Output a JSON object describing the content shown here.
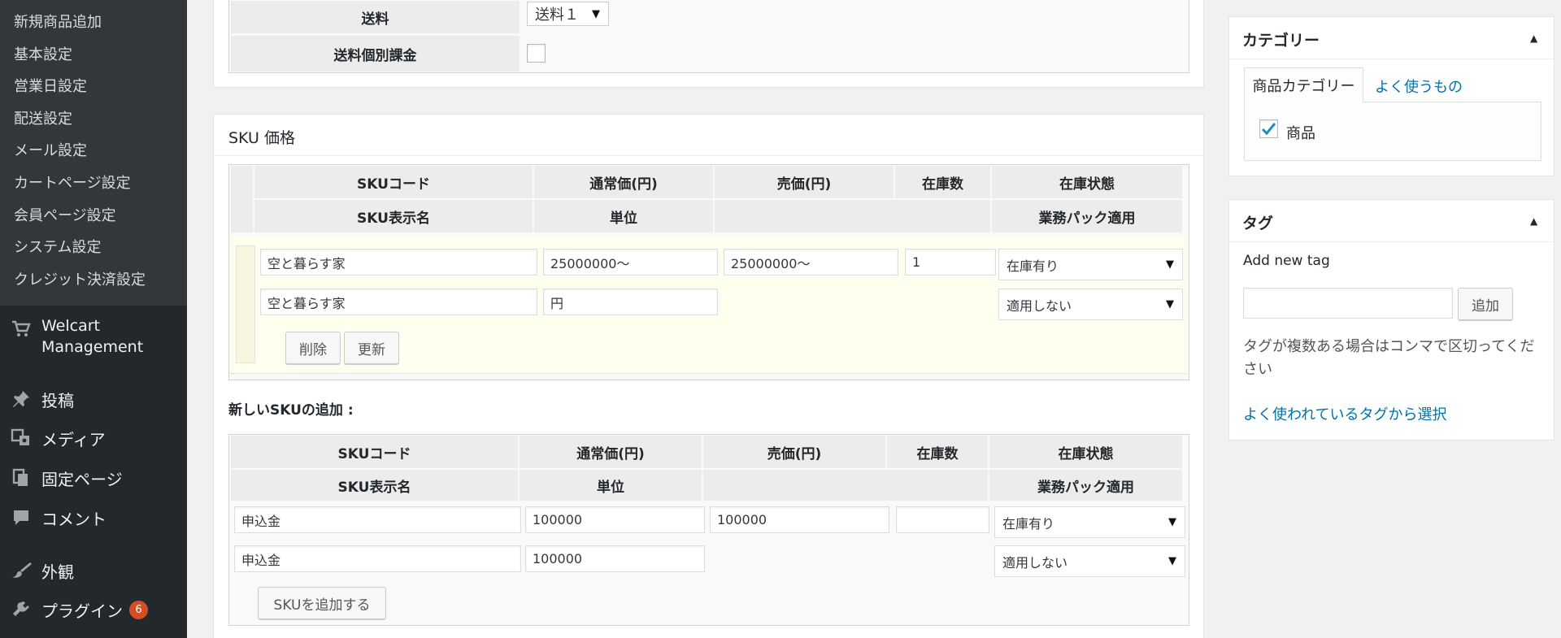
{
  "sidebar": {
    "submenu": [
      "新規商品追加",
      "基本設定",
      "営業日設定",
      "配送設定",
      "メール設定",
      "カートページ設定",
      "会員ページ設定",
      "システム設定",
      "クレジット決済設定"
    ],
    "welcart_line1": "Welcart",
    "welcart_line2": "Management",
    "posts": "投稿",
    "media": "メディア",
    "pages": "固定ページ",
    "comments": "コメント",
    "appearance": "外観",
    "plugins": "プラグイン",
    "plugins_badge": "6"
  },
  "shipping": {
    "label": "送料",
    "select_value": "送料１",
    "individual_label": "送料個別課金"
  },
  "sku": {
    "title": "SKU 価格",
    "headers_row1": [
      "SKUコード",
      "通常価(円)",
      "売価(円)",
      "在庫数",
      "在庫状態"
    ],
    "headers_row2": [
      "SKU表示名",
      "単位",
      "",
      "業務パック適用"
    ],
    "existing": {
      "code": "空と暮らす家",
      "regular_price": "25000000〜",
      "sale_price": "25000000〜",
      "stock": "1",
      "stock_status": "在庫有り",
      "display_name": "空と暮らす家",
      "unit": "円",
      "business_pack": "適用しない",
      "delete_label": "削除",
      "update_label": "更新"
    },
    "new_label": "新しいSKUの追加 :",
    "new": {
      "code": "申込金",
      "regular_price": "100000",
      "sale_price": "100000",
      "stock": "",
      "stock_status": "在庫有り",
      "display_name": "申込金",
      "unit": "100000",
      "business_pack": "適用しない",
      "add_label": "SKUを追加する"
    }
  },
  "category": {
    "title": "カテゴリー",
    "tab_all": "商品カテゴリー",
    "tab_popular": "よく使うもの",
    "item": "商品"
  },
  "tags": {
    "title": "タグ",
    "add_new_label": "Add new tag",
    "add_button": "追加",
    "hint": "タグが複数ある場合はコンマで区切ってください",
    "popular_link": "よく使われているタグから選択"
  },
  "colors": {
    "sidebar_bg": "#23282d",
    "submenu_bg": "#32373c",
    "link": "#0073aa",
    "badge": "#d54e21",
    "highlight_row": "#fffff0"
  }
}
